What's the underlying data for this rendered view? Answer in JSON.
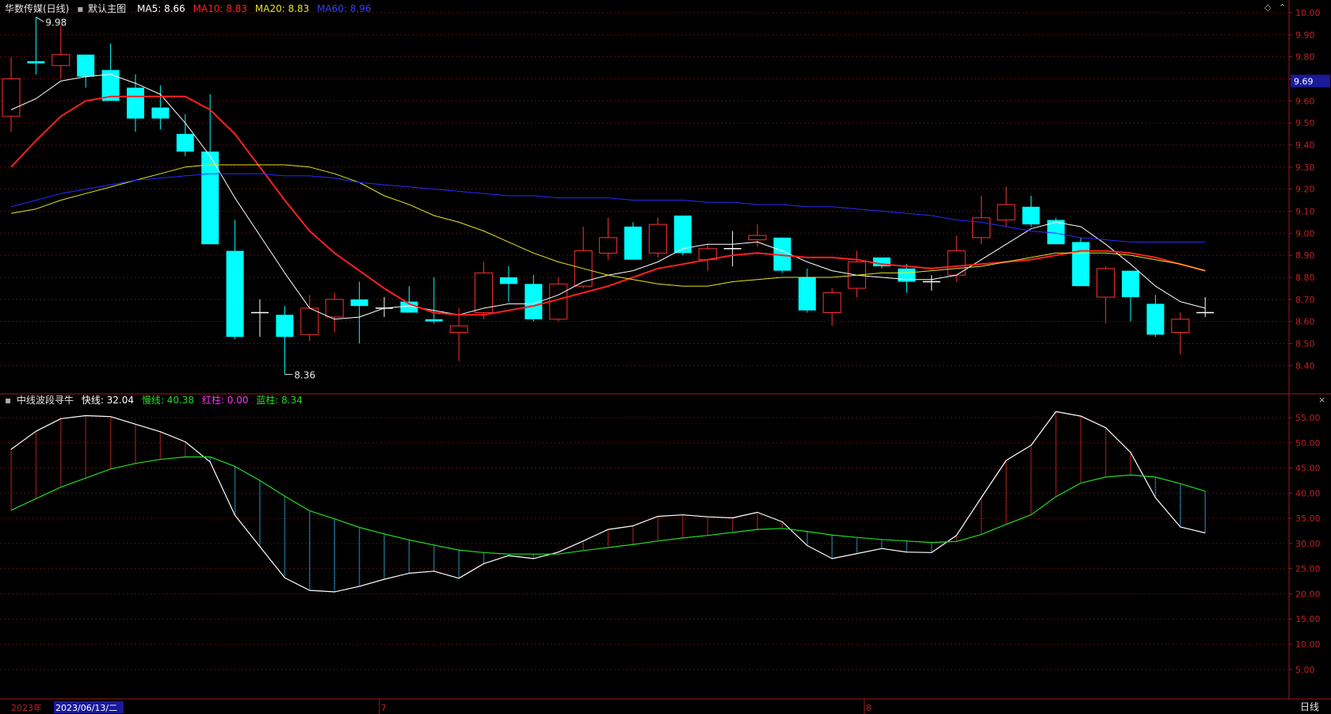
{
  "header": {
    "stock_name": "华数传媒(日线)",
    "main_chart_label": "默认主图",
    "ma5": {
      "label": "MA5: 8.66",
      "color": "#ffffff"
    },
    "ma10": {
      "label": "MA10: 8.83",
      "color": "#ff2020"
    },
    "ma20": {
      "label": "MA20: 8.83",
      "color": "#e6e620"
    },
    "ma60": {
      "label": "MA60: 8.96",
      "color": "#2b2bff"
    }
  },
  "indicator_header": {
    "name": "中线波段寻牛",
    "fast": {
      "label": "快线: 32.04",
      "color": "#ffffff"
    },
    "slow": {
      "label": "慢线: 40.38",
      "color": "#22dd22"
    },
    "red_bar": {
      "label": "红柱: 0.00",
      "color": "#ff33ff"
    },
    "blue_bar": {
      "label": "蓝柱: 8.34",
      "color": "#22dd22"
    }
  },
  "footer": {
    "year_label": "2023年",
    "date_label": "2023/06/13/二",
    "month_marks": [
      "7",
      "8"
    ],
    "period_label": "日线"
  },
  "price_tag": "9.69",
  "annotations": {
    "high": "9.98",
    "low": "8.36"
  },
  "chart_data": [
    {
      "type": "candlestick",
      "title": "华数传媒(日线)",
      "ylim": [
        8.32,
        10.02
      ],
      "y_ticks": [
        "10.00",
        "9.90",
        "9.80",
        "9.70",
        "9.60",
        "9.50",
        "9.40",
        "9.30",
        "9.20",
        "9.10",
        "9.00",
        "8.90",
        "8.80",
        "8.70",
        "8.60",
        "8.50",
        "8.40"
      ],
      "colors": {
        "up": "#ff3030",
        "down": "#00ffff",
        "flat": "#ffffff"
      },
      "candles": [
        {
          "o": 9.53,
          "h": 9.8,
          "l": 9.46,
          "c": 9.7
        },
        {
          "o": 9.78,
          "h": 9.98,
          "l": 9.72,
          "c": 9.77
        },
        {
          "o": 9.76,
          "h": 9.94,
          "l": 9.7,
          "c": 9.81
        },
        {
          "o": 9.81,
          "h": 9.81,
          "l": 9.66,
          "c": 9.71
        },
        {
          "o": 9.74,
          "h": 9.86,
          "l": 9.6,
          "c": 9.6
        },
        {
          "o": 9.66,
          "h": 9.72,
          "l": 9.46,
          "c": 9.52
        },
        {
          "o": 9.57,
          "h": 9.67,
          "l": 9.47,
          "c": 9.52
        },
        {
          "o": 9.45,
          "h": 9.54,
          "l": 9.35,
          "c": 9.37
        },
        {
          "o": 9.37,
          "h": 9.63,
          "l": 9.34,
          "c": 8.95
        },
        {
          "o": 8.92,
          "h": 9.06,
          "l": 8.52,
          "c": 8.53
        },
        {
          "o": 8.64,
          "h": 8.7,
          "l": 8.53,
          "c": 8.64
        },
        {
          "o": 8.63,
          "h": 8.67,
          "l": 8.36,
          "c": 8.53
        },
        {
          "o": 8.54,
          "h": 8.72,
          "l": 8.51,
          "c": 8.66
        },
        {
          "o": 8.62,
          "h": 8.73,
          "l": 8.55,
          "c": 8.7
        },
        {
          "o": 8.7,
          "h": 8.78,
          "l": 8.5,
          "c": 8.67
        },
        {
          "o": 8.66,
          "h": 8.71,
          "l": 8.62,
          "c": 8.66
        },
        {
          "o": 8.69,
          "h": 8.76,
          "l": 8.64,
          "c": 8.64
        },
        {
          "o": 8.61,
          "h": 8.8,
          "l": 8.59,
          "c": 8.6
        },
        {
          "o": 8.55,
          "h": 8.66,
          "l": 8.42,
          "c": 8.58
        },
        {
          "o": 8.64,
          "h": 8.87,
          "l": 8.61,
          "c": 8.82
        },
        {
          "o": 8.8,
          "h": 8.85,
          "l": 8.69,
          "c": 8.77
        },
        {
          "o": 8.77,
          "h": 8.81,
          "l": 8.6,
          "c": 8.61
        },
        {
          "o": 8.61,
          "h": 8.8,
          "l": 8.6,
          "c": 8.77
        },
        {
          "o": 8.76,
          "h": 9.03,
          "l": 8.75,
          "c": 8.92
        },
        {
          "o": 8.91,
          "h": 9.07,
          "l": 8.88,
          "c": 8.98
        },
        {
          "o": 9.03,
          "h": 9.05,
          "l": 8.88,
          "c": 8.88
        },
        {
          "o": 8.91,
          "h": 9.07,
          "l": 8.89,
          "c": 9.04
        },
        {
          "o": 9.08,
          "h": 9.08,
          "l": 8.9,
          "c": 8.91
        },
        {
          "o": 8.88,
          "h": 8.95,
          "l": 8.83,
          "c": 8.93
        },
        {
          "o": 8.93,
          "h": 9.01,
          "l": 8.85,
          "c": 8.93
        },
        {
          "o": 8.97,
          "h": 9.04,
          "l": 8.94,
          "c": 8.99
        },
        {
          "o": 8.98,
          "h": 8.98,
          "l": 8.82,
          "c": 8.83
        },
        {
          "o": 8.8,
          "h": 8.84,
          "l": 8.64,
          "c": 8.65
        },
        {
          "o": 8.64,
          "h": 8.75,
          "l": 8.58,
          "c": 8.73
        },
        {
          "o": 8.75,
          "h": 8.92,
          "l": 8.71,
          "c": 8.87
        },
        {
          "o": 8.89,
          "h": 8.89,
          "l": 8.84,
          "c": 8.85
        },
        {
          "o": 8.84,
          "h": 8.86,
          "l": 8.73,
          "c": 8.78
        },
        {
          "o": 8.78,
          "h": 8.81,
          "l": 8.74,
          "c": 8.78
        },
        {
          "o": 8.81,
          "h": 8.99,
          "l": 8.78,
          "c": 8.92
        },
        {
          "o": 8.98,
          "h": 9.17,
          "l": 8.95,
          "c": 9.07
        },
        {
          "o": 9.06,
          "h": 9.21,
          "l": 9.03,
          "c": 9.13
        },
        {
          "o": 9.12,
          "h": 9.17,
          "l": 9.03,
          "c": 9.04
        },
        {
          "o": 9.06,
          "h": 9.07,
          "l": 8.95,
          "c": 8.95
        },
        {
          "o": 8.96,
          "h": 8.98,
          "l": 8.76,
          "c": 8.76
        },
        {
          "o": 8.71,
          "h": 8.85,
          "l": 8.59,
          "c": 8.84
        },
        {
          "o": 8.83,
          "h": 8.83,
          "l": 8.6,
          "c": 8.71
        },
        {
          "o": 8.68,
          "h": 8.72,
          "l": 8.53,
          "c": 8.54
        },
        {
          "o": 8.55,
          "h": 8.64,
          "l": 8.45,
          "c": 8.61
        },
        {
          "o": 8.64,
          "h": 8.71,
          "l": 8.62,
          "c": 8.64
        }
      ],
      "ma_series": [
        {
          "name": "MA5",
          "color": "#ffffff",
          "width": 1,
          "values": [
            9.56,
            9.61,
            9.69,
            9.71,
            9.72,
            9.68,
            9.63,
            9.5,
            9.35,
            9.16,
            8.99,
            8.82,
            8.66,
            8.61,
            8.62,
            8.66,
            8.67,
            8.65,
            8.63,
            8.66,
            8.68,
            8.68,
            8.72,
            8.78,
            8.81,
            8.83,
            8.87,
            8.93,
            8.95,
            8.95,
            8.96,
            8.92,
            8.87,
            8.83,
            8.81,
            8.8,
            8.79,
            8.79,
            8.81,
            8.88,
            8.95,
            9.02,
            9.05,
            9.03,
            8.95,
            8.86,
            8.76,
            8.69,
            8.66
          ]
        },
        {
          "name": "MA10",
          "color": "#ff2020",
          "width": 2,
          "values": [
            9.3,
            9.42,
            9.53,
            9.6,
            9.62,
            9.62,
            9.62,
            9.62,
            9.56,
            9.45,
            9.3,
            9.15,
            9.01,
            8.91,
            8.83,
            8.75,
            8.68,
            8.64,
            8.63,
            8.63,
            8.65,
            8.67,
            8.7,
            8.73,
            8.76,
            8.8,
            8.84,
            8.86,
            8.88,
            8.9,
            8.91,
            8.9,
            8.89,
            8.89,
            8.88,
            8.86,
            8.85,
            8.84,
            8.85,
            8.86,
            8.87,
            8.88,
            8.9,
            8.92,
            8.92,
            8.91,
            8.89,
            8.86,
            8.83
          ]
        },
        {
          "name": "MA20",
          "color": "#e6e620",
          "width": 1,
          "values": [
            9.09,
            9.11,
            9.15,
            9.18,
            9.21,
            9.24,
            9.27,
            9.3,
            9.31,
            9.31,
            9.31,
            9.31,
            9.3,
            9.27,
            9.23,
            9.17,
            9.13,
            9.08,
            9.05,
            9.01,
            8.96,
            8.91,
            8.87,
            8.84,
            8.81,
            8.79,
            8.77,
            8.76,
            8.76,
            8.78,
            8.79,
            8.8,
            8.8,
            8.8,
            8.81,
            8.82,
            8.82,
            8.83,
            8.84,
            8.85,
            8.87,
            8.89,
            8.91,
            8.91,
            8.91,
            8.9,
            8.88,
            8.86,
            8.83
          ]
        },
        {
          "name": "MA60",
          "color": "#2b2bff",
          "width": 1,
          "values": [
            9.12,
            9.15,
            9.18,
            9.2,
            9.22,
            9.24,
            9.25,
            9.26,
            9.27,
            9.27,
            9.27,
            9.26,
            9.26,
            9.25,
            9.23,
            9.22,
            9.21,
            9.2,
            9.19,
            9.18,
            9.17,
            9.17,
            9.16,
            9.16,
            9.16,
            9.15,
            9.15,
            9.15,
            9.14,
            9.14,
            9.13,
            9.13,
            9.12,
            9.12,
            9.11,
            9.1,
            9.09,
            9.08,
            9.06,
            9.05,
            9.03,
            9.01,
            9.0,
            8.98,
            8.97,
            8.96,
            8.96,
            8.96,
            8.96
          ]
        }
      ]
    },
    {
      "type": "line",
      "title": "中线波段寻牛",
      "ylim": [
        2.5,
        57.5
      ],
      "y_ticks": [
        "55.00",
        "50.00",
        "45.00",
        "40.00",
        "35.00",
        "30.00",
        "25.00",
        "20.00",
        "15.00",
        "10.00",
        "5.00"
      ],
      "series": [
        {
          "name": "快线",
          "color": "#ffffff",
          "values": [
            48.7,
            52.3,
            54.8,
            55.4,
            55.2,
            53.7,
            52.2,
            50.2,
            46.2,
            35.6,
            29.4,
            23.2,
            20.7,
            20.4,
            21.5,
            22.9,
            24.1,
            24.5,
            23.1,
            26.0,
            27.6,
            27.0,
            28.3,
            30.5,
            32.8,
            33.5,
            35.4,
            35.7,
            35.3,
            35.1,
            36.2,
            34.3,
            29.6,
            27.0,
            28.0,
            29.0,
            28.3,
            28.2,
            31.6,
            39.1,
            46.5,
            49.5,
            56.2,
            55.3,
            53.0,
            48.1,
            39.1,
            33.3,
            32.1
          ]
        },
        {
          "name": "慢线",
          "color": "#22dd22",
          "values": [
            36.6,
            38.9,
            41.2,
            43.0,
            44.8,
            45.9,
            46.7,
            47.2,
            47.2,
            45.3,
            42.5,
            39.4,
            36.5,
            34.9,
            33.2,
            31.9,
            30.7,
            29.7,
            28.7,
            28.2,
            27.9,
            27.9,
            27.9,
            28.6,
            29.2,
            29.8,
            30.5,
            31.1,
            31.6,
            32.2,
            32.8,
            33.0,
            32.4,
            31.7,
            31.2,
            30.8,
            30.5,
            30.2,
            30.4,
            31.8,
            33.8,
            35.7,
            39.3,
            42.0,
            43.2,
            43.6,
            43.2,
            41.9,
            40.4
          ]
        }
      ]
    }
  ]
}
